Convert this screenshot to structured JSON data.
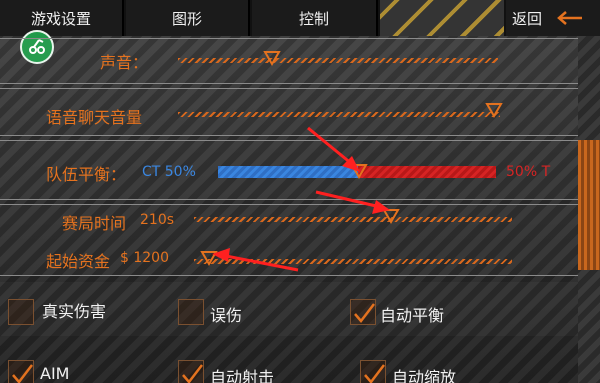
{
  "tabs": {
    "settings": "游戏设置",
    "graphics": "图形",
    "control": "控制",
    "back": "返回"
  },
  "icons": {
    "logo": "gamepad-logo-icon",
    "back": "back-arrow-icon",
    "slider_thumb": "triangle-down-icon",
    "checkmark": "checkmark-icon",
    "annotation": "red-arrow-icon"
  },
  "colors": {
    "accent": "#e4721f",
    "ct_blue": "#3a86e0",
    "t_red": "#d62424",
    "annotation_red": "#ff2020",
    "tab_text": "#f1f1f1"
  },
  "sliders": {
    "sound": {
      "label": "声音：",
      "level": 0.18
    },
    "voice_chat": {
      "label": "语音聊天音量",
      "level": 1.0
    },
    "team_balance": {
      "label": "队伍平衡：",
      "ct_label": "CT 50%",
      "t_label": "50% T",
      "level": 0.5
    },
    "round_time": {
      "label": "赛局时间",
      "value": "210s",
      "level": 0.62
    },
    "start_money": {
      "label": "起始资金",
      "value": "$ 1200",
      "level": 0.0
    }
  },
  "checkboxes": [
    {
      "label": "真实伤害",
      "checked": false
    },
    {
      "label": "误伤",
      "checked": false
    },
    {
      "label": "自动平衡",
      "checked": true
    },
    {
      "label": "AIM",
      "checked": true
    },
    {
      "label": "自动射击",
      "checked": true
    },
    {
      "label": "自动缩放",
      "checked": true
    }
  ]
}
